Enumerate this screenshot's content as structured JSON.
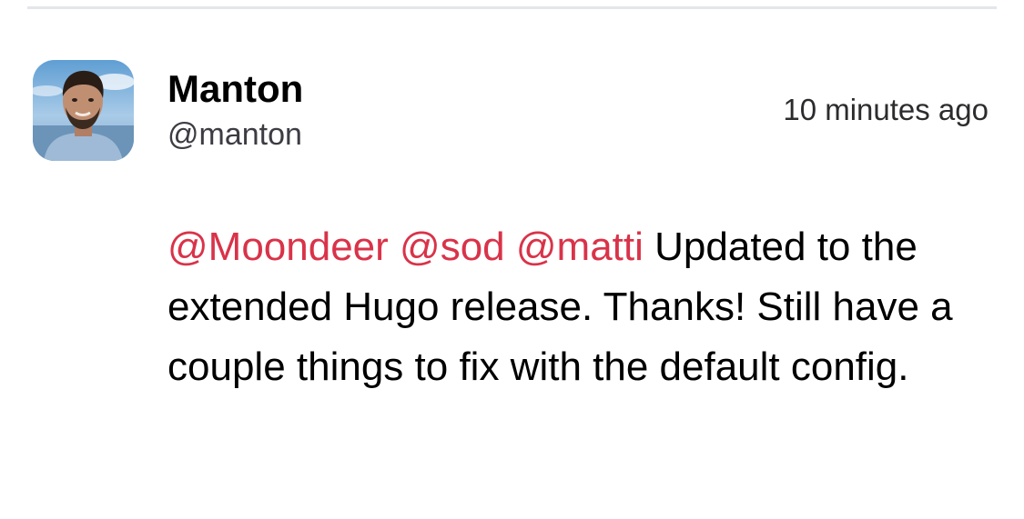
{
  "post": {
    "author": {
      "name": "Manton",
      "handle": "@manton",
      "avatar_icon": "user-avatar-photo"
    },
    "timestamp": "10 minutes ago",
    "mentions": [
      "@Moondeer",
      "@sod",
      "@matti"
    ],
    "text": "Updated to the extended Hugo release. Thanks! Still have a couple things to fix with the default config."
  },
  "colors": {
    "mention": "#d93349",
    "divider": "#e3e6ea",
    "text": "#000000",
    "secondary_text": "#3c3c43"
  }
}
